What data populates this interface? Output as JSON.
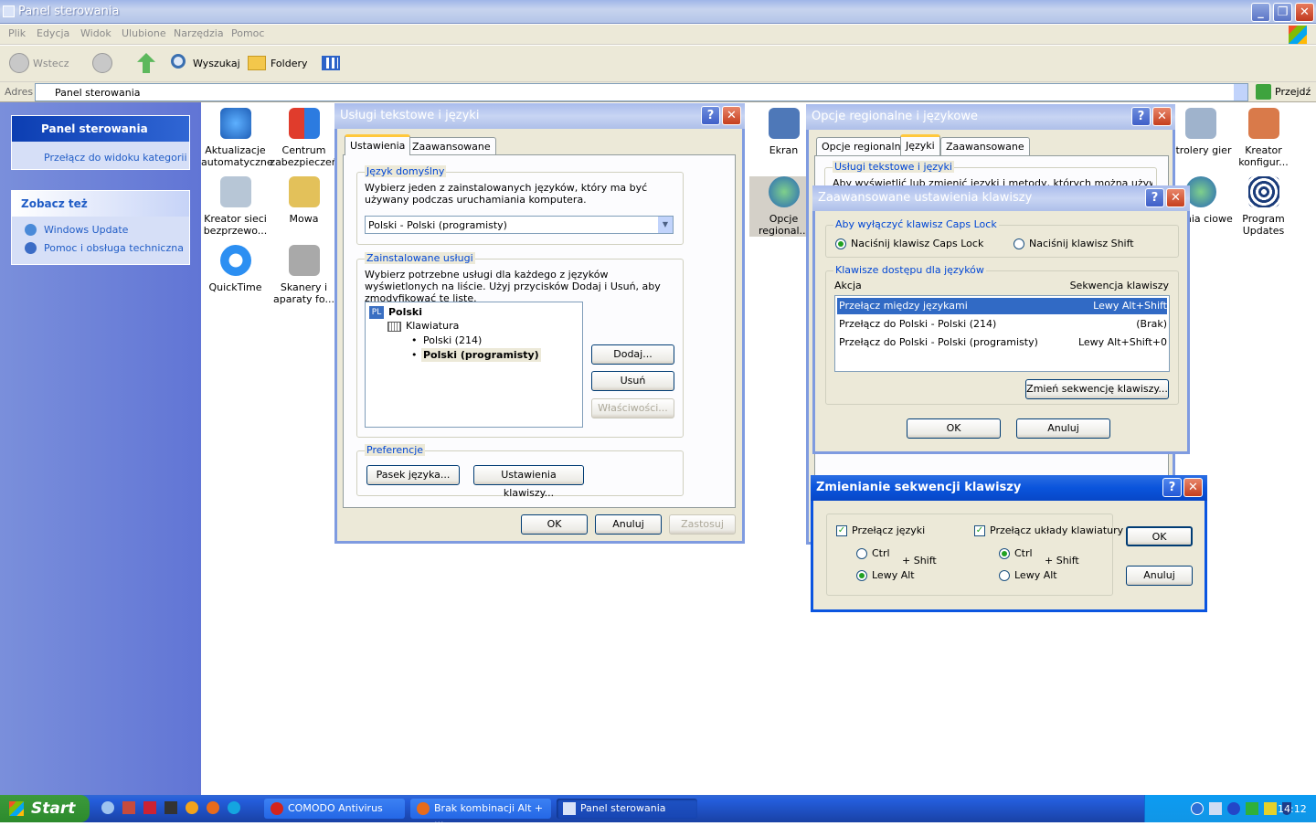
{
  "window": {
    "title": "Panel sterowania"
  },
  "menu": [
    "Plik",
    "Edycja",
    "Widok",
    "Ulubione",
    "Narzędzia",
    "Pomoc"
  ],
  "toolbar": {
    "back": "Wstecz",
    "search": "Wyszukaj",
    "folders": "Foldery"
  },
  "address": {
    "label": "Adres",
    "value": "Panel sterowania",
    "go": "Przejdź"
  },
  "sidebar": {
    "panel_title": "Panel sterowania",
    "switch_link": "Przełącz do widoku kategorii",
    "see_also_title": "Zobacz też",
    "links": [
      "Windows Update",
      "Pomoc i obsługa techniczna"
    ]
  },
  "icons": {
    "i1": "Aktualizacje automatyczne",
    "i2": "Centrum zabezpieczeń",
    "i3": "Kreator sieci bezprzewo...",
    "i4": "Mowa",
    "i5": "QuickTime",
    "i6": "Skanery i aparaty fo...",
    "i7": "Ekran",
    "i8": "Opcje regional...",
    "i9": "ntrolery gier",
    "i10": "Kreator konfigur...",
    "i11": "czenia ciowe",
    "i12": "Program Updates"
  },
  "dlg1": {
    "title": "Usługi tekstowe i języki",
    "tabs": [
      "Ustawienia",
      "Zaawansowane"
    ],
    "group1": "Język domyślny",
    "desc1": "Wybierz jeden z zainstalowanych języków, który ma być używany podczas uruchamiania komputera.",
    "select": "Polski - Polski (programisty)",
    "group2": "Zainstalowane usługi",
    "desc2": "Wybierz potrzebne usługi dla każdego z języków wyświetlonych na liście. Użyj przycisków Dodaj i Usuń, aby zmodyfikować tę listę.",
    "tree": {
      "badge": "PL",
      "lang": "Polski",
      "kbd": "Klawiatura",
      "l1": "Polski (214)",
      "l2": "Polski (programisty)"
    },
    "add": "Dodaj...",
    "remove": "Usuń",
    "props": "Właściwości...",
    "group3": "Preferencje",
    "langbar": "Pasek języka...",
    "keys": "Ustawienia klawiszy...",
    "ok": "OK",
    "cancel": "Anuluj",
    "apply": "Zastosuj"
  },
  "dlg2": {
    "title": "Opcje regionalne i językowe",
    "tabs": [
      "Opcje regionalne",
      "Języki",
      "Zaawansowane"
    ],
    "group": "Usługi tekstowe i języki",
    "desc": "Aby wyświetlić lub zmienić języki i metody, których można używać do"
  },
  "dlg3": {
    "title": "Zaawansowane ustawienia klawiszy",
    "group1": "Aby wyłączyć klawisz Caps Lock",
    "r1": "Naciśnij klawisz Caps Lock",
    "r2": "Naciśnij klawisz Shift",
    "group2": "Klawisze dostępu dla języków",
    "col_action": "Akcja",
    "col_seq": "Sekwencja klawiszy",
    "rows": [
      {
        "a": "Przełącz między językami",
        "s": "Lewy Alt+Shift"
      },
      {
        "a": "Przełącz do Polski - Polski (214)",
        "s": "(Brak)"
      },
      {
        "a": "Przełącz do Polski - Polski (programisty)",
        "s": "Lewy Alt+Shift+0"
      }
    ],
    "change": "Zmień sekwencję klawiszy...",
    "ok": "OK",
    "cancel": "Anuluj"
  },
  "dlg4": {
    "title": "Zmienianie sekwencji klawiszy",
    "c1": "Przełącz języki",
    "c2": "Przełącz układy klawiatury",
    "ctrl": "Ctrl",
    "lalt": "Lewy Alt",
    "plus_shift": "+ Shift",
    "ok": "OK",
    "cancel": "Anuluj"
  },
  "taskbar": {
    "start": "Start",
    "items": [
      "COMODO Antivirus",
      "Brak kombinacji Alt + ...",
      "Panel sterowania"
    ],
    "clock": "14:12"
  },
  "colors": {
    "selection": "#316ac5",
    "accent": "#0046d5",
    "taskbar": "#245ddb"
  }
}
